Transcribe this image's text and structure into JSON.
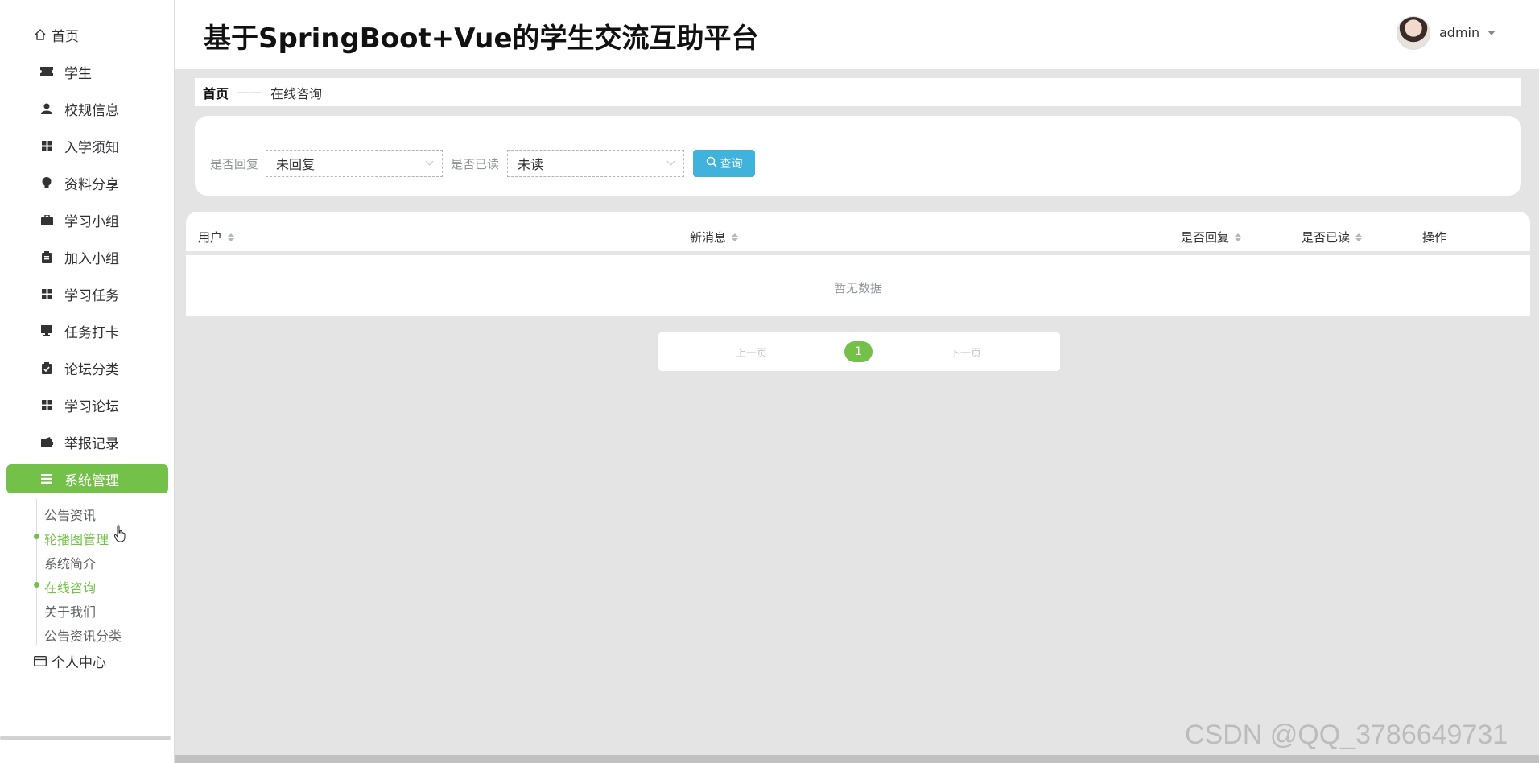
{
  "app_title": "基于SpringBoot+Vue的学生交流互助平台",
  "user": {
    "name": "admin"
  },
  "sidebar": {
    "home": "首页",
    "items": [
      {
        "label": "学生",
        "icon": "ticket-icon"
      },
      {
        "label": "校规信息",
        "icon": "user-icon"
      },
      {
        "label": "入学须知",
        "icon": "grid-icon"
      },
      {
        "label": "资料分享",
        "icon": "bulb-icon"
      },
      {
        "label": "学习小组",
        "icon": "briefcase-icon"
      },
      {
        "label": "加入小组",
        "icon": "clipboard-icon"
      },
      {
        "label": "学习任务",
        "icon": "grid-icon"
      },
      {
        "label": "任务打卡",
        "icon": "monitor-icon"
      },
      {
        "label": "论坛分类",
        "icon": "checklist-icon"
      },
      {
        "label": "学习论坛",
        "icon": "grid-icon"
      },
      {
        "label": "举报记录",
        "icon": "wallet-icon"
      },
      {
        "label": "系统管理",
        "icon": "menu-icon",
        "active": true
      }
    ],
    "submenu": [
      "公告资讯",
      "轮播图管理",
      "系统简介",
      "在线咨询",
      "关于我们",
      "公告资讯分类"
    ],
    "personal": "个人中心"
  },
  "breadcrumb": {
    "home": "首页",
    "separator": "——",
    "current": "在线咨询"
  },
  "filters": {
    "replied_label": "是否回复",
    "replied_value": "未回复",
    "read_label": "是否已读",
    "read_value": "未读",
    "search_button": "查询"
  },
  "table": {
    "columns": [
      "用户",
      "新消息",
      "是否回复",
      "是否已读",
      "操作"
    ],
    "empty_text": "暂无数据"
  },
  "pagination": {
    "prev": "上一页",
    "current_page": "1",
    "next": "下一页"
  },
  "watermark": "CSDN @QQ_3786649731",
  "colors": {
    "accent": "#74c14a",
    "button": "#3fb3dc"
  }
}
